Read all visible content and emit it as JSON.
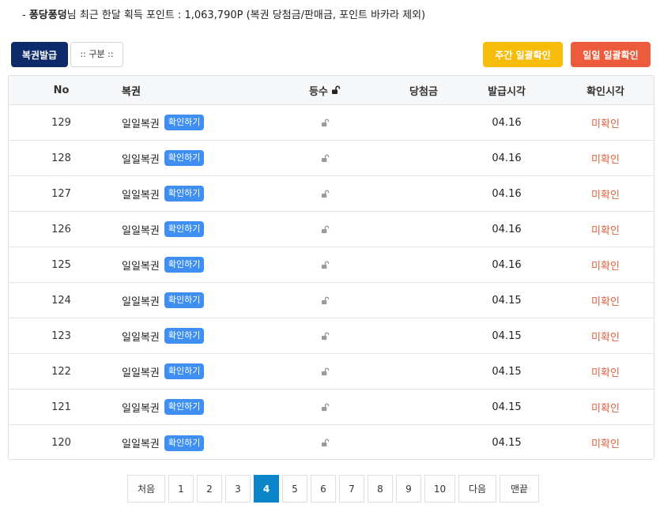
{
  "summary": {
    "prefix": "- ",
    "user": "퐁당퐁덩",
    "text": "님 최근 한달 획득 포인트 : 1,063,790P (복권 당첨금/판매금, 포인트 바카라 제외)"
  },
  "toolbar": {
    "issue_label": "복권발급",
    "category_label": ":: 구분 ::",
    "weekly_label": "주간 일괄확인",
    "daily_label": "일일 일괄확인"
  },
  "table": {
    "headers": {
      "no": "No",
      "name": "복권",
      "rank": "등수",
      "prize": "당첨금",
      "issued": "발급시각",
      "checked": "확인시각"
    },
    "rows": [
      {
        "no": "129",
        "name": "일일복권",
        "button": "확인하기",
        "prize": "",
        "issued": "04.16",
        "status": "미확인"
      },
      {
        "no": "128",
        "name": "일일복권",
        "button": "확인하기",
        "prize": "",
        "issued": "04.16",
        "status": "미확인"
      },
      {
        "no": "127",
        "name": "일일복권",
        "button": "확인하기",
        "prize": "",
        "issued": "04.16",
        "status": "미확인"
      },
      {
        "no": "126",
        "name": "일일복권",
        "button": "확인하기",
        "prize": "",
        "issued": "04.16",
        "status": "미확인"
      },
      {
        "no": "125",
        "name": "일일복권",
        "button": "확인하기",
        "prize": "",
        "issued": "04.16",
        "status": "미확인"
      },
      {
        "no": "124",
        "name": "일일복권",
        "button": "확인하기",
        "prize": "",
        "issued": "04.15",
        "status": "미확인"
      },
      {
        "no": "123",
        "name": "일일복권",
        "button": "확인하기",
        "prize": "",
        "issued": "04.15",
        "status": "미확인"
      },
      {
        "no": "122",
        "name": "일일복권",
        "button": "확인하기",
        "prize": "",
        "issued": "04.15",
        "status": "미확인"
      },
      {
        "no": "121",
        "name": "일일복권",
        "button": "확인하기",
        "prize": "",
        "issued": "04.15",
        "status": "미확인"
      },
      {
        "no": "120",
        "name": "일일복권",
        "button": "확인하기",
        "prize": "",
        "issued": "04.15",
        "status": "미확인"
      }
    ]
  },
  "pagination": {
    "first": "처음",
    "pages": [
      "1",
      "2",
      "3",
      "4",
      "5",
      "6",
      "7",
      "8",
      "9",
      "10"
    ],
    "current": "4",
    "next": "다음",
    "last": "맨끝"
  },
  "icons": {
    "rank_header": "unlock-icon",
    "row_rank": "unlock-icon"
  },
  "colors": {
    "issue_button": "#0d2a6b",
    "weekly_button": "#f7bc0a",
    "daily_button": "#ec5b3b",
    "confirm_badge": "#3f8ff2",
    "status_text": "#e0613f",
    "active_page": "#0b85c9"
  }
}
